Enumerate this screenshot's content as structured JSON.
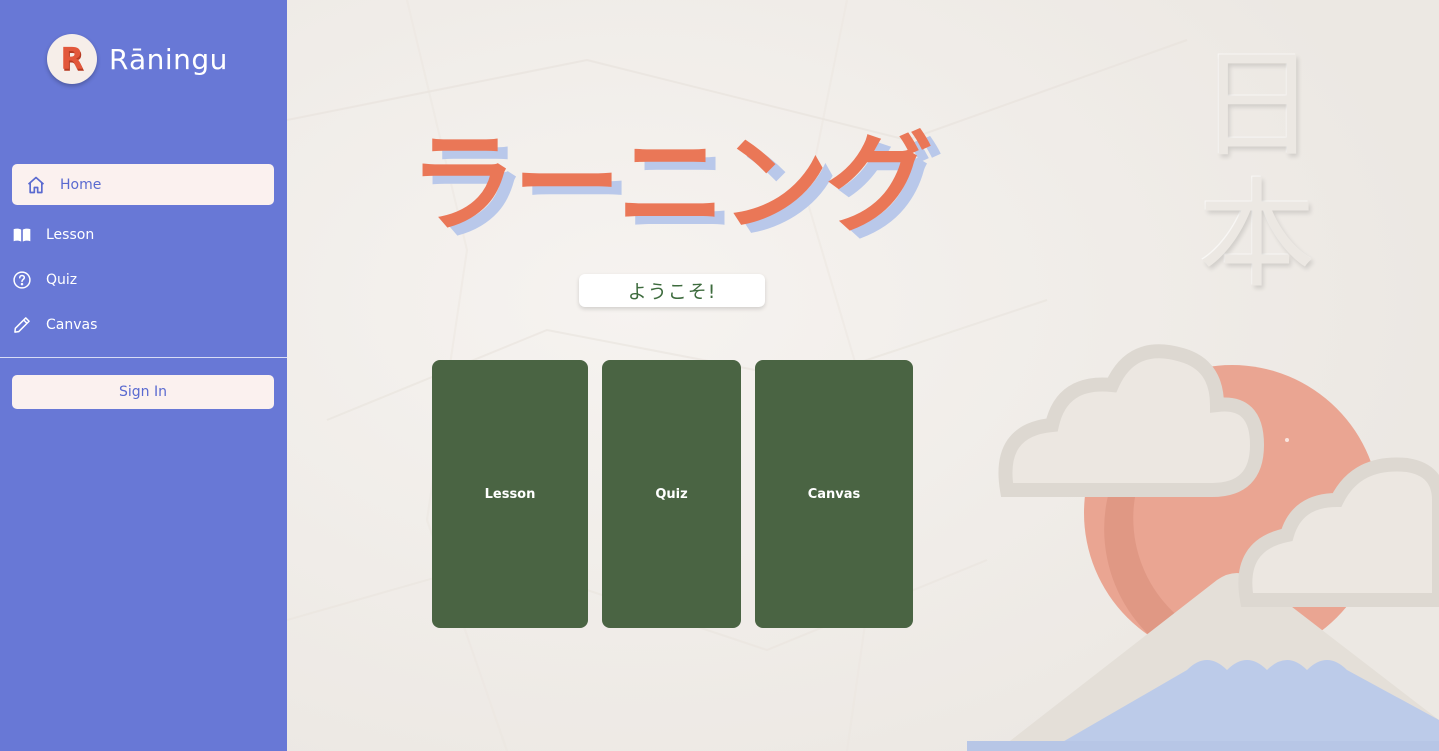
{
  "brand": {
    "logo_letter": "R",
    "name": "Rāningu"
  },
  "sidebar": {
    "items": [
      {
        "label": "Home",
        "icon": "home-icon",
        "active": true
      },
      {
        "label": "Lesson",
        "icon": "book-icon",
        "active": false
      },
      {
        "label": "Quiz",
        "icon": "question-circle-icon",
        "active": false
      },
      {
        "label": "Canvas",
        "icon": "pencil-icon",
        "active": false
      }
    ],
    "signin_label": "Sign In"
  },
  "main": {
    "title": "ラーニング",
    "welcome": "ようこそ!",
    "cards": [
      {
        "label": "Lesson"
      },
      {
        "label": "Quiz"
      },
      {
        "label": "Canvas"
      }
    ],
    "kanji": [
      "日",
      "本"
    ]
  },
  "colors": {
    "sidebar_bg": "#6878d6",
    "accent_active_bg": "#fbf1ef",
    "card_green": "#4a6443",
    "title_orange": "#ea7757",
    "title_shadow_blue": "#b9c8ea",
    "sun": "#eaa592",
    "mountain": "#bccbe9"
  }
}
